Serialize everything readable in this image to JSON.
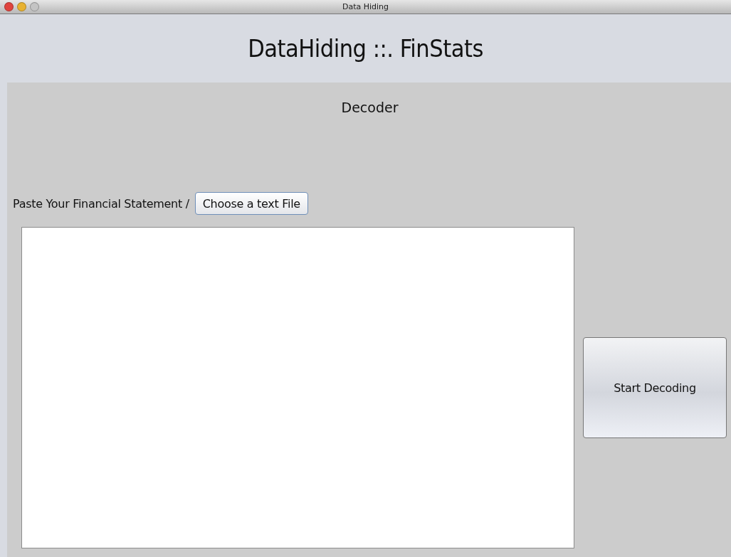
{
  "window": {
    "title": "Data Hiding"
  },
  "header": {
    "title": "DataHiding ::. FinStats"
  },
  "panel": {
    "heading": "Decoder",
    "input_label": "Paste Your Financial Statement /",
    "choose_button": "Choose a text File",
    "start_button": "Start Decoding"
  }
}
